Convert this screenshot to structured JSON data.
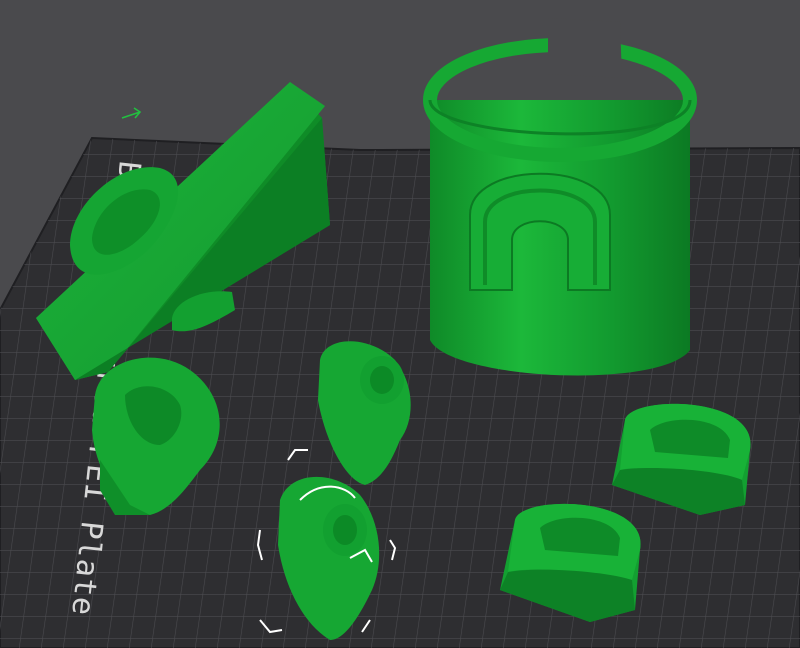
{
  "app": {
    "view": "3D preview",
    "bed": {
      "label": "Bambu Textured PEI Plate",
      "surface_color": "#2e2e31",
      "grid_color": "#4b4b4f"
    },
    "background_color": "#4a4a4d",
    "model_color": "#16a832",
    "selection_color": "#ffffff",
    "objects": [
      {
        "name": "flat-base-plate-part"
      },
      {
        "name": "cylindrical-cup-holder"
      },
      {
        "name": "oval-clip-left"
      },
      {
        "name": "oval-clip-middle"
      },
      {
        "name": "oval-clip-selected"
      },
      {
        "name": "u-bracket-right-top"
      },
      {
        "name": "u-bracket-right-bottom"
      }
    ],
    "icons": [
      "axis-gizmo-icon"
    ]
  }
}
